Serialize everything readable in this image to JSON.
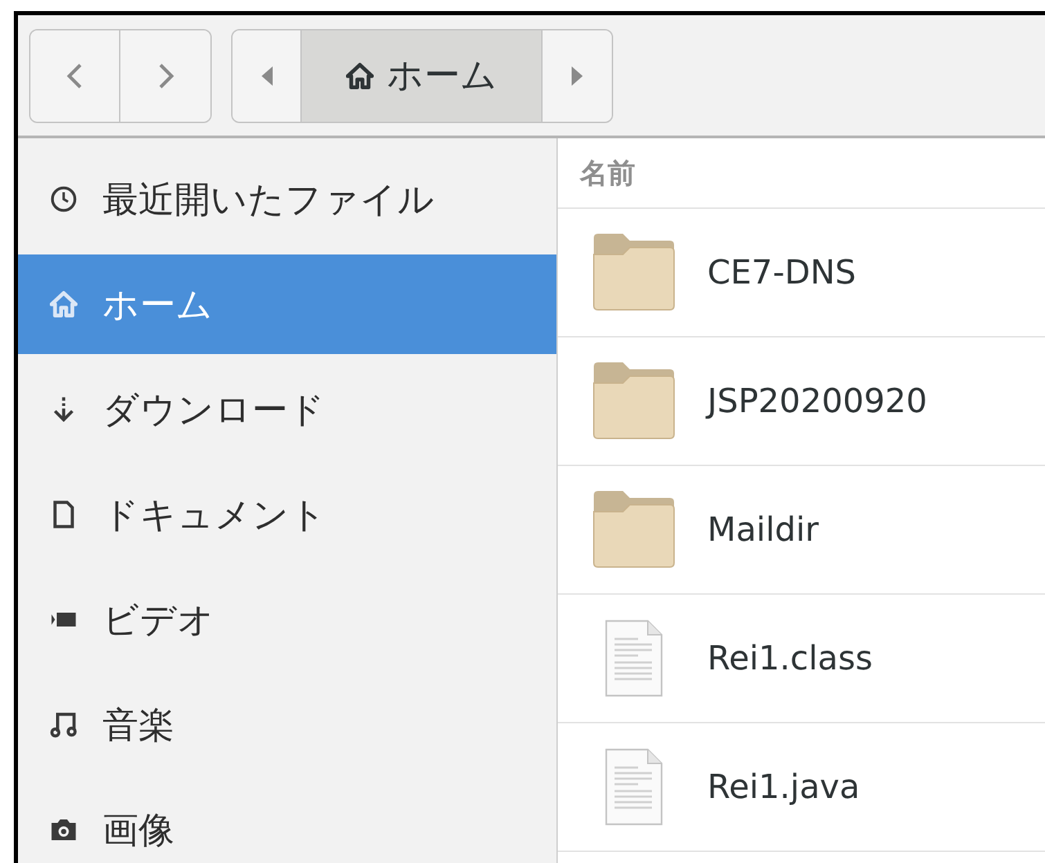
{
  "toolbar": {
    "path": [
      {
        "kind": "scroll-left"
      },
      {
        "kind": "location",
        "label": "ホーム",
        "selected": true
      },
      {
        "kind": "scroll-right"
      }
    ]
  },
  "sidebar": {
    "items": [
      {
        "kind": "clock",
        "label": "最近開いたファイル",
        "selected": false
      },
      {
        "kind": "home",
        "label": "ホーム",
        "selected": true
      },
      {
        "kind": "download",
        "label": "ダウンロード",
        "selected": false
      },
      {
        "kind": "document",
        "label": "ドキュメント",
        "selected": false
      },
      {
        "kind": "video",
        "label": "ビデオ",
        "selected": false
      },
      {
        "kind": "music",
        "label": "音楽",
        "selected": false
      },
      {
        "kind": "camera",
        "label": "画像",
        "selected": false
      }
    ]
  },
  "list": {
    "columns": [
      "名前"
    ],
    "rows": [
      {
        "kind": "folder",
        "name": "CE7-DNS"
      },
      {
        "kind": "folder",
        "name": "JSP20200920"
      },
      {
        "kind": "folder",
        "name": "Maildir"
      },
      {
        "kind": "file",
        "name": "Rei1.class"
      },
      {
        "kind": "file",
        "name": "Rei1.java"
      }
    ]
  }
}
